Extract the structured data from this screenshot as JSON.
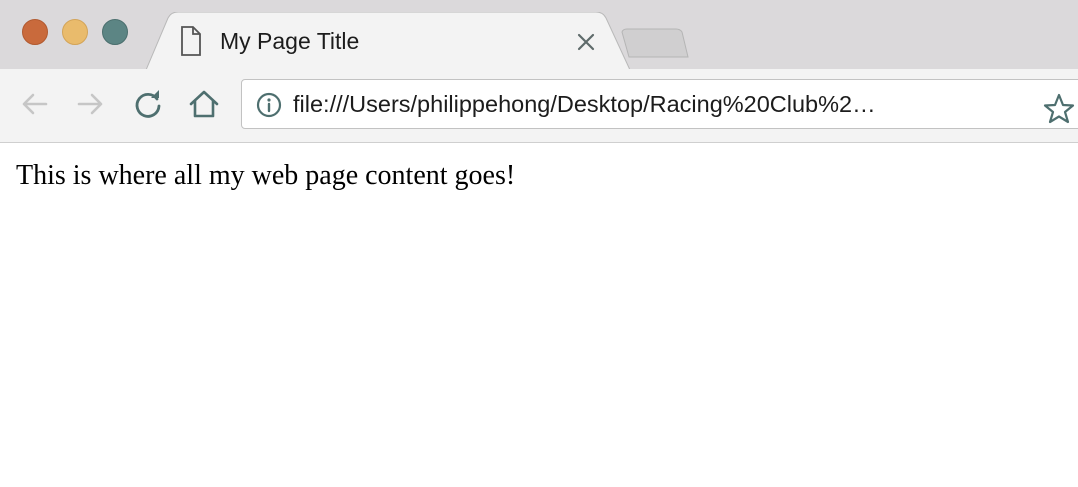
{
  "window": {
    "traffic_lights": {
      "close_color": "#c96a3c",
      "minimize_color": "#e9bb6c",
      "maximize_color": "#5c8584"
    }
  },
  "tab": {
    "title": "My Page Title",
    "icon": "document-icon",
    "close_icon": "close-icon"
  },
  "new_tab": {
    "icon": "new-tab-icon"
  },
  "toolbar": {
    "back_icon": "back-arrow-icon",
    "forward_icon": "forward-arrow-icon",
    "reload_icon": "reload-icon",
    "home_icon": "home-icon"
  },
  "address_bar": {
    "security_icon": "info-icon",
    "url": "file:///Users/philippehong/Desktop/Racing%20Club%2…",
    "bookmark_icon": "star-icon"
  },
  "page": {
    "body_text": "This is where all my web page content goes!"
  },
  "colors": {
    "tabstrip_bg": "#dbd9db",
    "toolbar_bg": "#f3f3f3",
    "icon_color": "#4e6f6f",
    "disabled_icon_color": "#c6c6c6"
  }
}
